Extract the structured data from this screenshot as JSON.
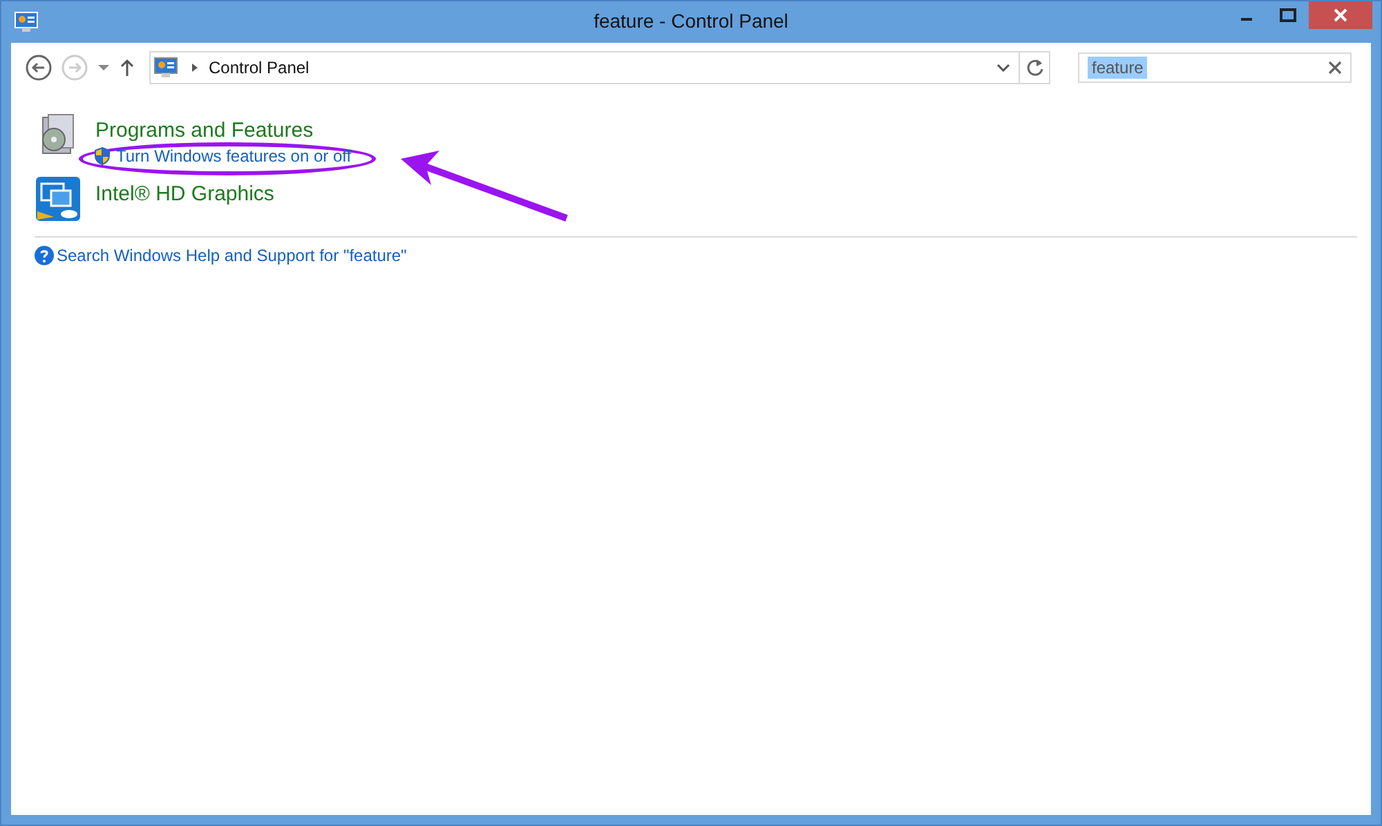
{
  "window": {
    "title": "feature - Control Panel"
  },
  "nav": {
    "back_enabled": true,
    "forward_enabled": false
  },
  "address": {
    "crumbs": [
      "Control Panel"
    ]
  },
  "search": {
    "value": "feature",
    "selected": true
  },
  "results": [
    {
      "kind": "programs",
      "title": "Programs and Features",
      "links": [
        "Turn Windows features on or off"
      ],
      "highlighted": true
    },
    {
      "kind": "intel",
      "title": "Intel® HD Graphics"
    }
  ],
  "help_link": "Search Windows Help and Support for \"feature\""
}
